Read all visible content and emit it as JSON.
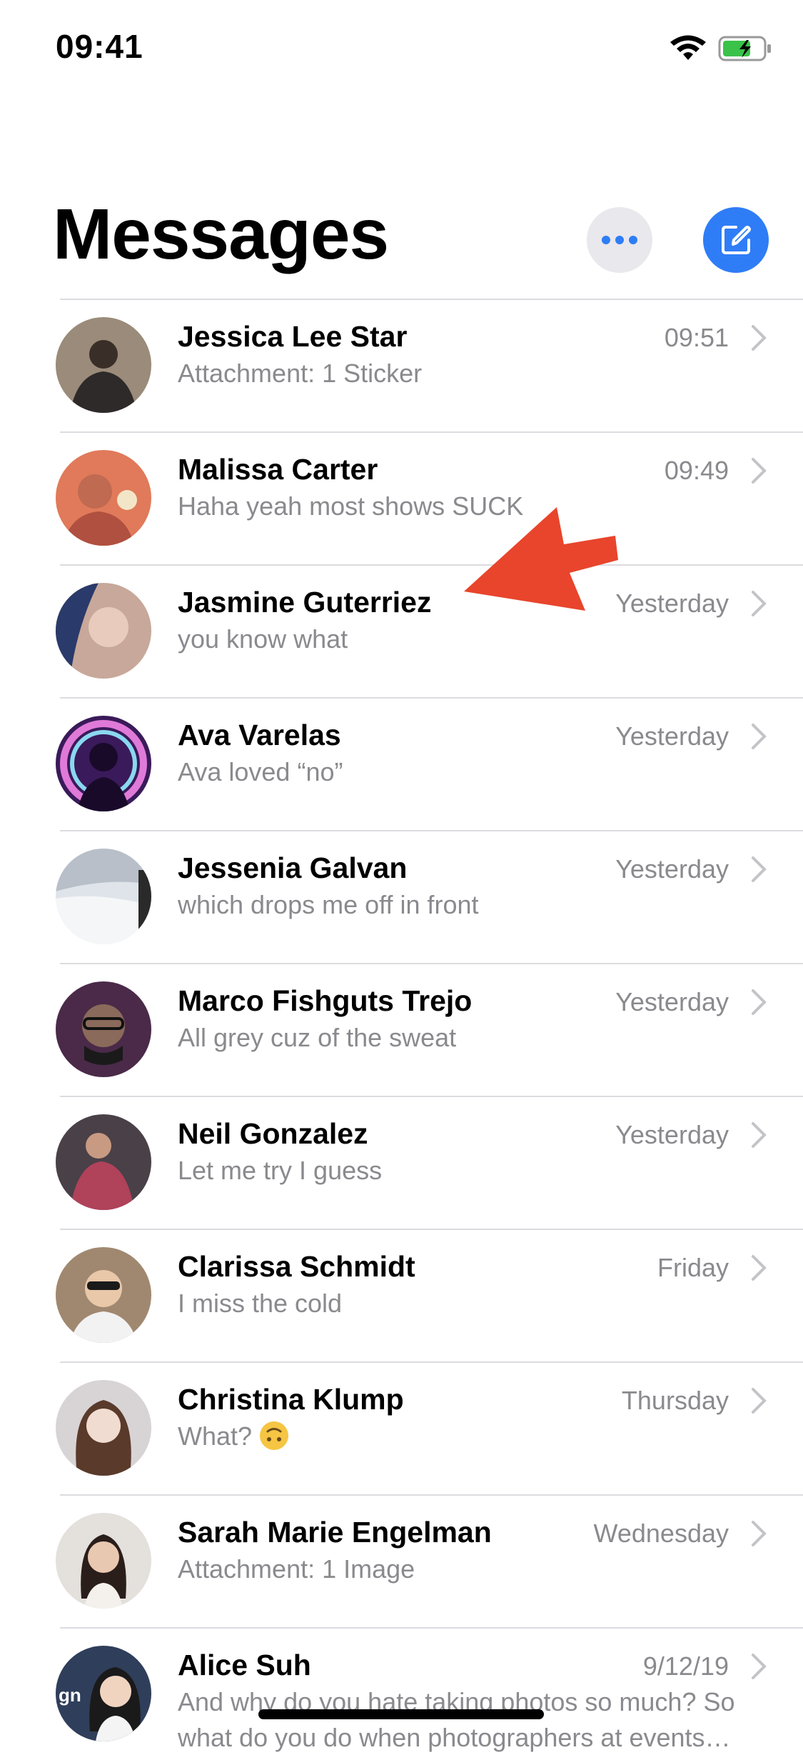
{
  "status_bar": {
    "time": "09:41"
  },
  "header": {
    "title": "Messages"
  },
  "conversations": [
    {
      "name": "Jessica Lee Star",
      "preview": "Attachment: 1 Sticker",
      "time": "09:51",
      "avatar_color": "#9a8b7a"
    },
    {
      "name": "Malissa Carter",
      "preview": "Haha yeah most shows SUCK",
      "time": "09:49",
      "avatar_color": "#e07a5a"
    },
    {
      "name": "Jasmine Guterriez",
      "preview": "you know what",
      "time": "Yesterday",
      "avatar_color": "#c7a89a"
    },
    {
      "name": "Ava Varelas",
      "preview": "Ava loved “no”",
      "time": "Yesterday",
      "avatar_color": "#5a2a7a"
    },
    {
      "name": "Jessenia Galvan",
      "preview": "which drops me off in front",
      "time": "Yesterday",
      "avatar_color": "#d8dde3"
    },
    {
      "name": "Marco Fishguts Trejo",
      "preview": "All grey cuz of the sweat",
      "time": "Yesterday",
      "avatar_color": "#4a2a48"
    },
    {
      "name": "Neil Gonzalez",
      "preview": "Let me try I guess",
      "time": "Yesterday",
      "avatar_color": "#5a4a52"
    },
    {
      "name": "Clarissa Schmidt",
      "preview": "I miss the cold",
      "time": "Friday",
      "avatar_color": "#b59a7e"
    },
    {
      "name": "Christina Klump",
      "preview": "What?",
      "time": "Thursday",
      "avatar_color": "#c9c4c6"
    },
    {
      "name": "Sarah Marie Engelman",
      "preview": "Attachment: 1 Image",
      "time": "Wednesday",
      "avatar_color": "#d8d4cf"
    },
    {
      "name": "Alice Suh",
      "preview": "And why do you hate taking photos so much? So what do you do when photographers at events…",
      "time": "9/12/19",
      "avatar_color": "#2f3e5a",
      "avatar_text": "gn"
    }
  ],
  "colors": {
    "accent": "#2f7df6",
    "annotation_arrow": "#e8452c"
  },
  "icons": {
    "more": "ellipsis-icon",
    "compose": "compose-icon",
    "row": "chevron-right-icon"
  }
}
